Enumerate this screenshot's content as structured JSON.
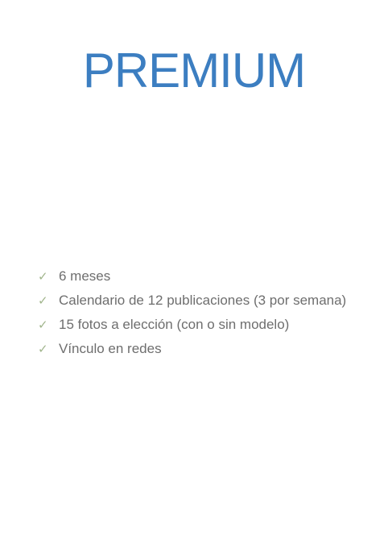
{
  "plan": {
    "title": "PREMIUM",
    "features": [
      {
        "icon": "check-icon",
        "label": "6 meses"
      },
      {
        "icon": "check-icon",
        "label": "Calendario de 12 publicaciones (3 por semana)"
      },
      {
        "icon": "check-icon",
        "label": "15 fotos a elección (con o sin modelo)"
      },
      {
        "icon": "check-icon",
        "label": "Vínculo en redes"
      }
    ]
  },
  "colors": {
    "title": "#3c7ec1",
    "check": "#a1b58c",
    "text": "#6e6e6e",
    "background": "#ffffff"
  }
}
